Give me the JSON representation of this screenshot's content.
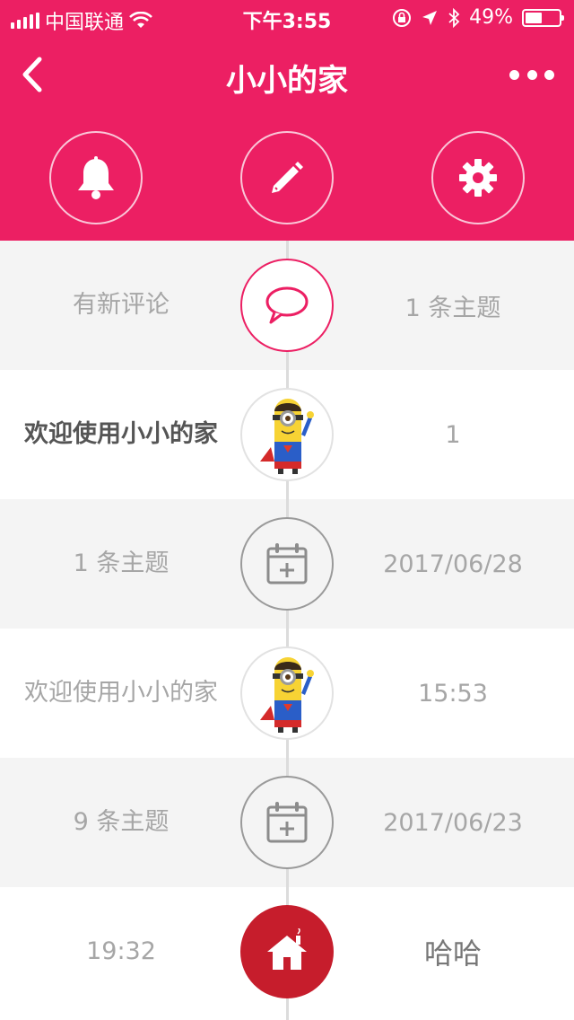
{
  "status_bar": {
    "carrier": "中国联通",
    "time": "下午3:55",
    "battery": "49%",
    "battery_level": 0.49
  },
  "nav": {
    "title": "小小的家"
  },
  "icons": {
    "back": "chevron-left-icon",
    "more": "more-dots-icon",
    "bell": "bell-icon",
    "edit": "pencil-icon",
    "settings": "gear-icon",
    "comment": "speech-bubble-icon",
    "calendar": "calendar-plus-icon",
    "home": "home-icon"
  },
  "colors": {
    "brand": "#ec1f63",
    "home_node": "#c61d2c",
    "row_gray": "#f4f4f4",
    "text_light": "#a6a6a6"
  },
  "timeline": {
    "rows": [
      {
        "left": "有新评论",
        "right": "1 条主题",
        "node": "comment"
      },
      {
        "left": "欢迎使用小小的家",
        "right": "1",
        "node": "avatar"
      },
      {
        "left": "1 条主题",
        "right": "2017/06/28",
        "node": "calendar"
      },
      {
        "left": "欢迎使用小小的家",
        "right": "15:53",
        "node": "avatar"
      },
      {
        "left": "9 条主题",
        "right": "2017/06/23",
        "node": "calendar"
      },
      {
        "left": "19:32",
        "right": "哈哈",
        "node": "home"
      }
    ]
  }
}
